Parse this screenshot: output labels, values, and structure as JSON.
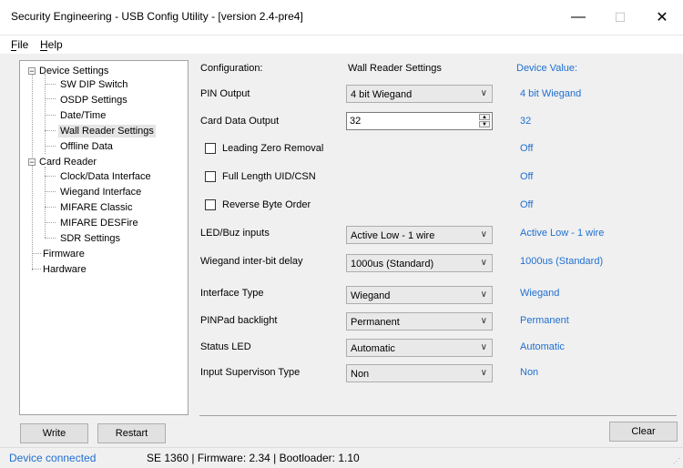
{
  "window": {
    "title": "Security Engineering - USB Config Utility - [version 2.4-pre4]",
    "min_glyph": "—",
    "max_glyph": "☐",
    "close_glyph": "✕"
  },
  "menu": {
    "file": "File",
    "help": "Help"
  },
  "tree": {
    "device_settings": "Device Settings",
    "sw_dip": "SW DIP Switch",
    "osdp": "OSDP Settings",
    "datetime": "Date/Time",
    "wall_reader": "Wall Reader Settings",
    "offline": "Offline Data",
    "card_reader": "Card Reader",
    "clock_data": "Clock/Data Interface",
    "wiegand": "Wiegand Interface",
    "mifare_classic": "MIFARE Classic",
    "mifare_desfire": "MIFARE DESFire",
    "sdr": "SDR Settings",
    "firmware": "Firmware",
    "hardware": "Hardware",
    "expander_glyph": "−"
  },
  "config": {
    "header_label": "Configuration:",
    "header_value": "Wall Reader Settings",
    "header_device": "Device Value:",
    "pin_output": {
      "label": "PIN Output",
      "value": "4 bit Wiegand",
      "device": "4 bit Wiegand"
    },
    "card_data_output": {
      "label": "Card Data Output",
      "value": "32",
      "device": "32"
    },
    "leading_zero": {
      "label": "Leading Zero Removal",
      "checked": false,
      "device": "Off"
    },
    "full_length": {
      "label": "Full Length UID/CSN",
      "checked": false,
      "device": "Off"
    },
    "reverse_byte": {
      "label": "Reverse Byte Order",
      "checked": false,
      "device": "Off"
    },
    "led_buz": {
      "label": "LED/Buz inputs",
      "value": "Active Low - 1 wire",
      "device": "Active Low - 1 wire"
    },
    "wiegand_delay": {
      "label": "Wiegand inter-bit delay",
      "value": "1000us (Standard)",
      "device": "1000us (Standard)"
    },
    "interface_type": {
      "label": "Interface Type",
      "value": "Wiegand",
      "device": "Wiegand"
    },
    "pinpad_backlight": {
      "label": "PINPad backlight",
      "value": "Permanent",
      "device": "Permanent"
    },
    "status_led": {
      "label": "Status LED",
      "value": "Automatic",
      "device": "Automatic"
    },
    "input_supervision": {
      "label": "Input Supervison Type",
      "value": "Non",
      "device": "Non"
    },
    "dropdown_glyph": "∨"
  },
  "buttons": {
    "write": "Write",
    "restart": "Restart",
    "clear": "Clear"
  },
  "status": {
    "connected": "Device connected",
    "info": "SE 1360 | Firmware: 2.34 | Bootloader: 1.10"
  },
  "colors": {
    "device_value": "#1f6fd0",
    "status_connected": "#1f6fd0"
  }
}
